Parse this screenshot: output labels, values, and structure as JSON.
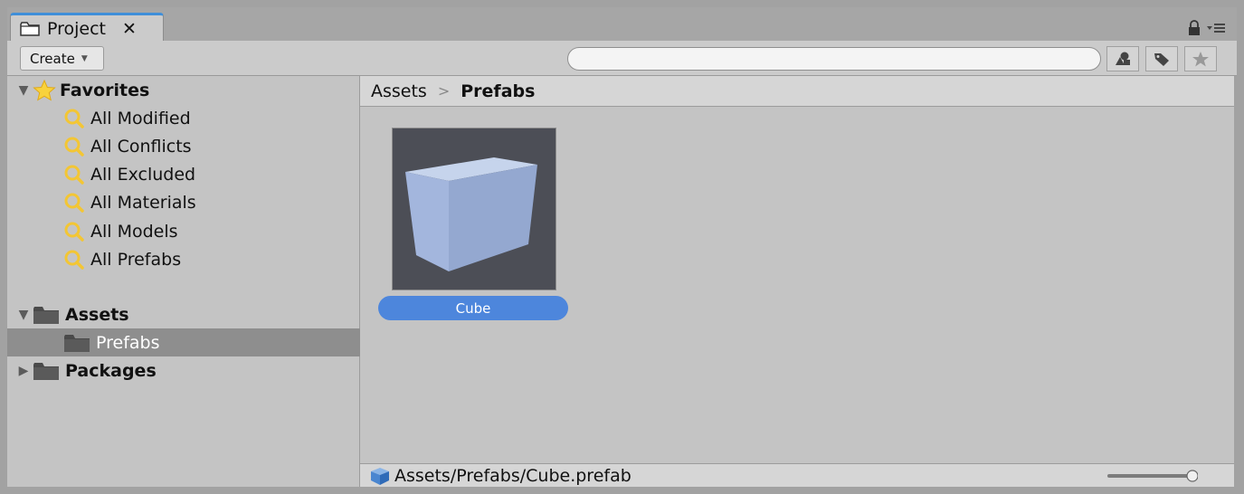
{
  "window": {
    "tab_label": "Project"
  },
  "toolbar": {
    "create_label": "Create",
    "search_value": "",
    "search_placeholder": ""
  },
  "tree": {
    "favorites_label": "Favorites",
    "favorites": [
      "All Modified",
      "All Conflicts",
      "All Excluded",
      "All Materials",
      "All Models",
      "All Prefabs"
    ],
    "assets_label": "Assets",
    "assets_child": "Prefabs",
    "packages_label": "Packages"
  },
  "breadcrumb": {
    "root": "Assets",
    "current": "Prefabs"
  },
  "assets": [
    {
      "label": "Cube"
    }
  ],
  "footer": {
    "path": "Assets/Prefabs/Cube.prefab"
  },
  "zoom": {
    "level_fraction": 1.0
  },
  "colors": {
    "accent": "#4d86dc",
    "selection": "#8e8e8e",
    "tab_border": "#3f8fd9"
  }
}
